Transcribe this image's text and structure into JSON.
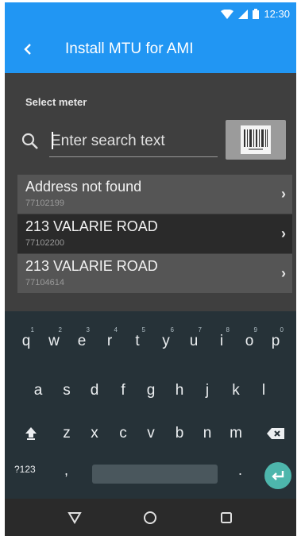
{
  "status_bar": {
    "time": "12:30"
  },
  "app_bar": {
    "title": "Install MTU for AMI",
    "back_icon": "back-chevron-icon"
  },
  "search": {
    "section_label": "Select meter",
    "placeholder": "Enter search text",
    "value": ""
  },
  "meters": [
    {
      "name": "Address not found",
      "id": "77102199",
      "selected": false
    },
    {
      "name": "213 VALARIE ROAD",
      "id": "77102200",
      "selected": true
    },
    {
      "name": "213 VALARIE ROAD",
      "id": "77104614",
      "selected": false
    }
  ],
  "keyboard": {
    "row1": [
      {
        "key": "q",
        "hint": "1"
      },
      {
        "key": "w",
        "hint": "2"
      },
      {
        "key": "e",
        "hint": "3"
      },
      {
        "key": "r",
        "hint": "4"
      },
      {
        "key": "t",
        "hint": "5"
      },
      {
        "key": "y",
        "hint": "6"
      },
      {
        "key": "u",
        "hint": "7"
      },
      {
        "key": "i",
        "hint": "8"
      },
      {
        "key": "o",
        "hint": "9"
      },
      {
        "key": "p",
        "hint": "0"
      }
    ],
    "row2": [
      "a",
      "s",
      "d",
      "f",
      "g",
      "h",
      "j",
      "k",
      "l"
    ],
    "row3": [
      "z",
      "x",
      "c",
      "v",
      "b",
      "n",
      "m"
    ],
    "symbols": "?123",
    "comma": ",",
    "period": "."
  },
  "colors": {
    "accent": "#2196f3",
    "enter": "#4db6ac",
    "keyboard_bg": "#263238"
  }
}
